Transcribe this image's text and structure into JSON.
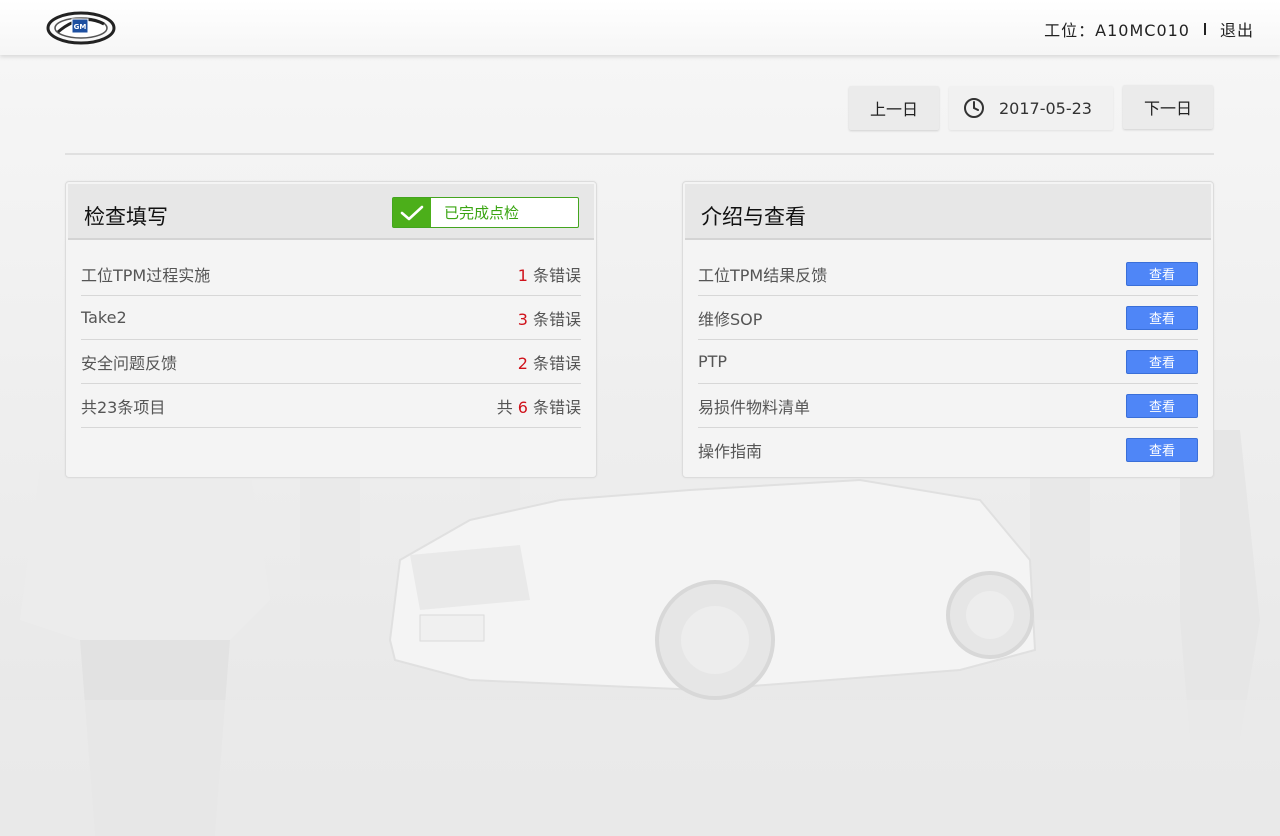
{
  "header": {
    "station_label": "工位：A10MC010",
    "logout_label": "退出"
  },
  "datebar": {
    "prev_label": "上一日",
    "date_value": "2017-05-23",
    "next_label": "下一日"
  },
  "check_panel": {
    "title": "检查填写",
    "status_text": "已完成点检",
    "rows": [
      {
        "label": "工位TPM过程实施",
        "prefix": "",
        "count": "1",
        "suffix": "条错误"
      },
      {
        "label": "Take2",
        "prefix": "",
        "count": "3",
        "suffix": "条错误"
      },
      {
        "label": "安全问题反馈",
        "prefix": "",
        "count": "2",
        "suffix": "条错误"
      },
      {
        "label": "共23条项目",
        "prefix": "共",
        "count": "6",
        "suffix": "条错误"
      }
    ]
  },
  "intro_panel": {
    "title": "介绍与查看",
    "items": [
      {
        "label": "工位TPM结果反馈",
        "button": "查看"
      },
      {
        "label": "维修SOP",
        "button": "查看"
      },
      {
        "label": "PTP",
        "button": "查看"
      },
      {
        "label": "易损件物料清单",
        "button": "查看"
      },
      {
        "label": "操作指南",
        "button": "查看"
      }
    ]
  },
  "colors": {
    "accent_green": "#4caf1a",
    "error_red": "#d0121b",
    "view_button_blue": "#4f86f7"
  },
  "icons": [
    "gm-logo",
    "clock-icon",
    "checkmark-icon"
  ]
}
